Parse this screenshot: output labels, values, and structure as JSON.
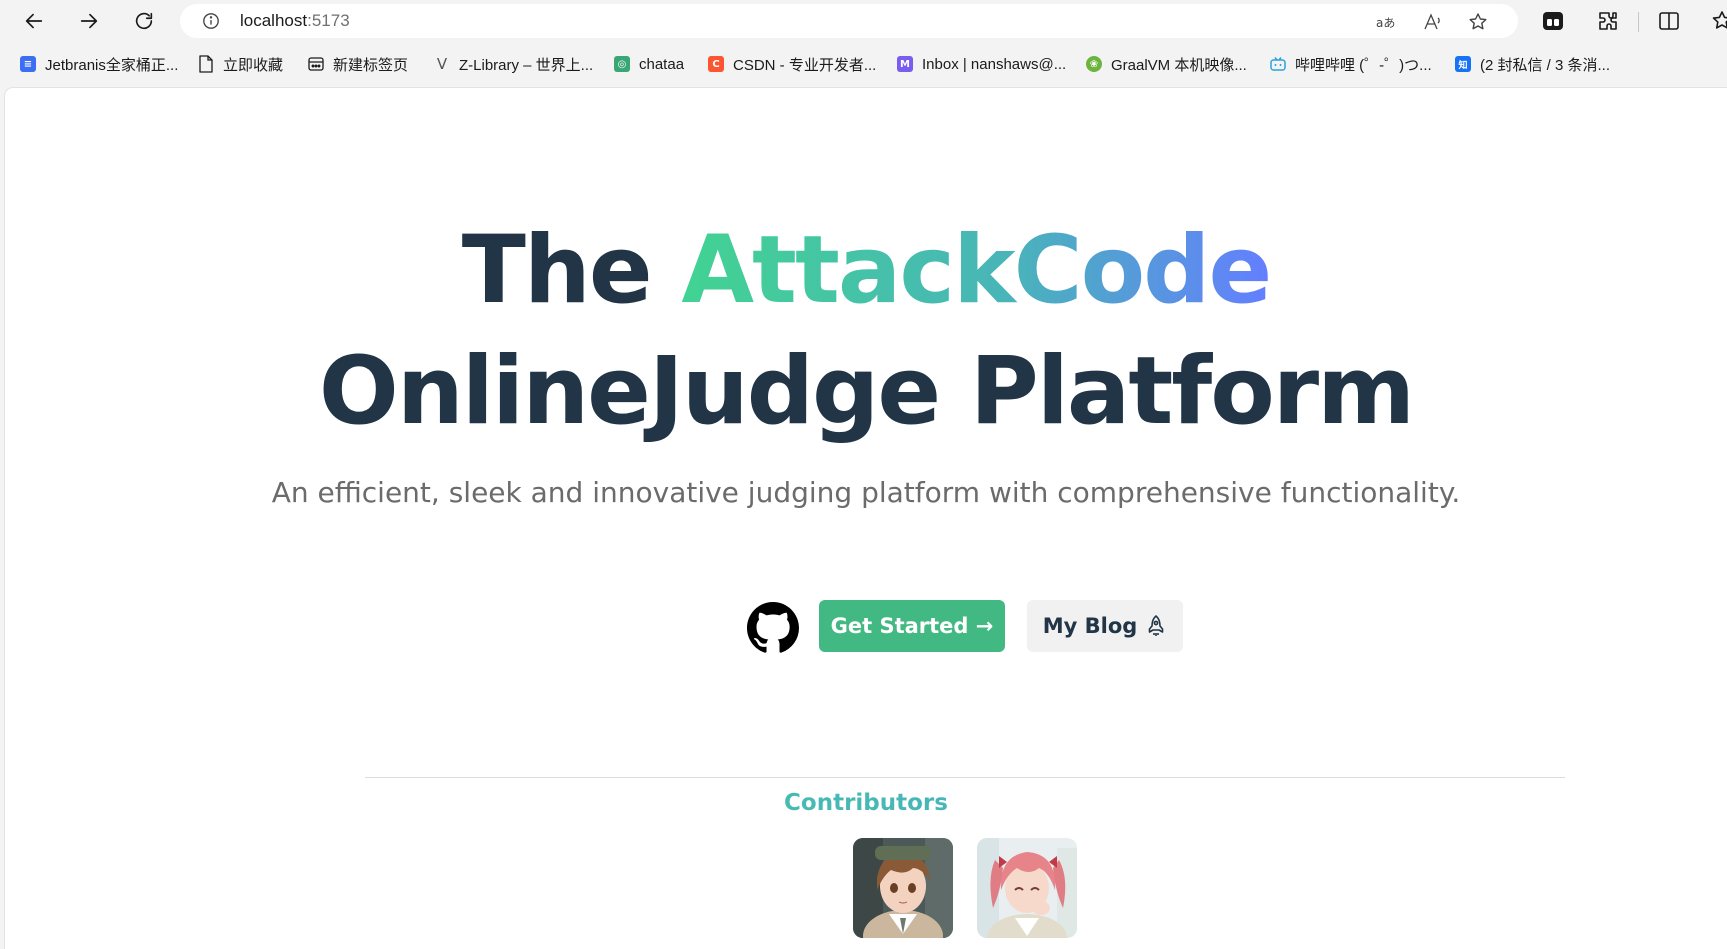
{
  "browser": {
    "url_host": "localhost",
    "url_port": ":5173",
    "icons": [
      "back-arrow-icon",
      "forward-arrow-icon",
      "refresh-icon",
      "info-icon",
      "translate-icon",
      "read-aloud-icon",
      "favorite-star-icon",
      "collections-icon",
      "extensions-icon",
      "split-screen-icon",
      "favorites-icon"
    ]
  },
  "bookmarks": [
    {
      "label": "Jetbranis全家桶正...",
      "icon": "doc-icon",
      "color": "#3b6ef5"
    },
    {
      "label": "立即收藏",
      "icon": "page-icon",
      "color": "#ffffff"
    },
    {
      "label": "新建标签页",
      "icon": "newtab-icon",
      "color": "#ffffff"
    },
    {
      "label": "Z-Library – 世界上...",
      "icon": "zlib-icon",
      "color": "#ffffff"
    },
    {
      "label": "chataa",
      "icon": "chat-icon",
      "color": "#3aa675"
    },
    {
      "label": "CSDN - 专业开发者...",
      "icon": "csdn-icon",
      "color": "#fc5531"
    },
    {
      "label": "Inbox | nanshaws@...",
      "icon": "mail-icon",
      "color": "#7b5cf0"
    },
    {
      "label": "GraalVM 本机映像...",
      "icon": "spring-icon",
      "color": "#6db33f"
    },
    {
      "label": "哔哩哔哩 (゜-゜)つ...",
      "icon": "bilibili-icon",
      "color": "#2aa1db"
    },
    {
      "label": "(2 封私信 / 3 条消...",
      "icon": "zhihu-icon",
      "color": "#1772f6"
    }
  ],
  "hero": {
    "line1_prefix": "The ",
    "line1_highlight": "AttackCode",
    "line2": "OnlineJudge Platform",
    "tagline": "An efficient, sleek and innovative judging platform with comprehensive functionality."
  },
  "actions": {
    "get_started": "Get Started →",
    "my_blog": "My Blog"
  },
  "contributors": {
    "title": "Contributors"
  },
  "colors": {
    "brand_green": "#42b883",
    "heading": "#213547",
    "gradient_start": "#42d392",
    "gradient_end": "#647eff"
  }
}
